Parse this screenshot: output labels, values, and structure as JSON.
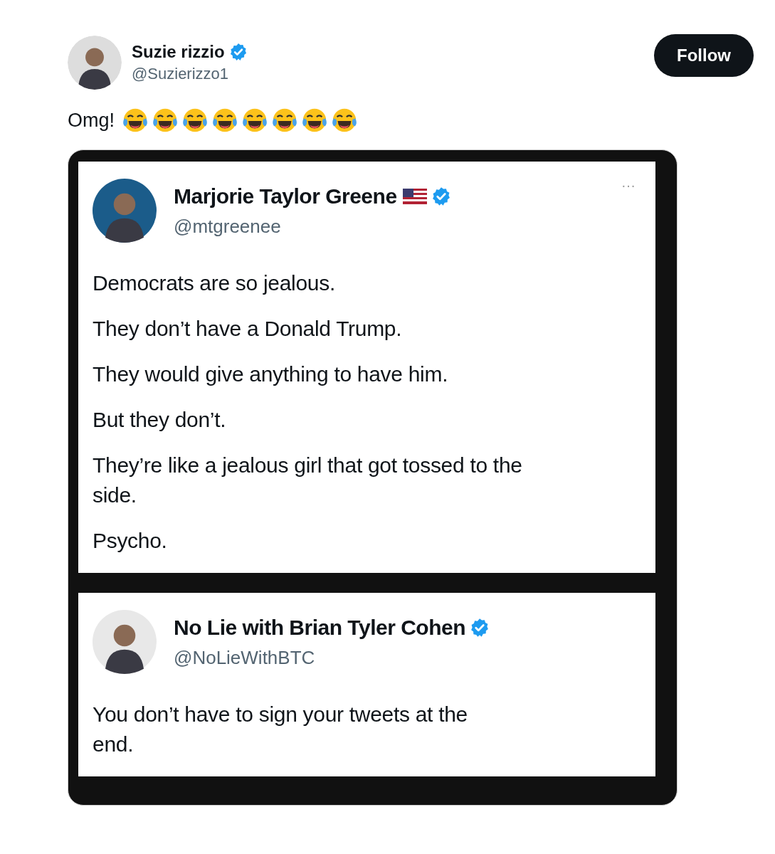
{
  "post": {
    "author": "Suzie rizzio",
    "badges": [
      {
        "kind": "verified"
      }
    ],
    "handle": "@Suzierizzo1",
    "follow_label": "Follow",
    "text": "Omg!",
    "emojis": [
      {
        "kind": "tears-of-joy"
      },
      {
        "kind": "tears-of-joy"
      },
      {
        "kind": "tears-of-joy"
      },
      {
        "kind": "tears-of-joy"
      },
      {
        "kind": "tears-of-joy"
      },
      {
        "kind": "tears-of-joy"
      },
      {
        "kind": "tears-of-joy"
      },
      {
        "kind": "tears-of-joy"
      }
    ]
  },
  "media": {
    "tweets": [
      {
        "author": "Marjorie Taylor Greene",
        "badges": [
          {
            "kind": "flag"
          },
          {
            "kind": "verified"
          }
        ],
        "more_label": "···",
        "handle": "@mtgreenee",
        "paragraphs": [
          "Democrats are so jealous.",
          "They don’t have a Donald Trump.",
          "They would give anything to have him.",
          "But they don’t.",
          "They’re like a jealous girl that got tossed to the side.",
          "Psycho."
        ]
      },
      {
        "author": "No Lie with Brian Tyler Cohen",
        "badges": [
          {
            "kind": "verified"
          }
        ],
        "handle": "@NoLieWithBTC",
        "paragraphs": [
          "You don’t have to sign your tweets at the end."
        ]
      }
    ]
  }
}
